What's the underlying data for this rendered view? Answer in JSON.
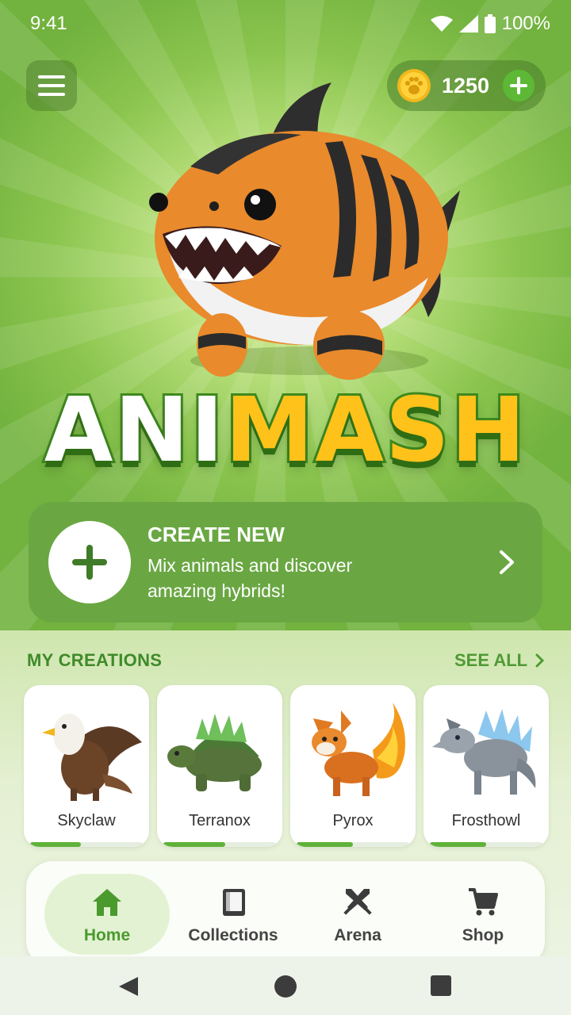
{
  "status_bar": {
    "time": "9:41",
    "battery": "100%"
  },
  "coins": {
    "count": "1250"
  },
  "logo": {
    "part1": "ANI",
    "part2": "MASH"
  },
  "create_card": {
    "title": "CREATE NEW",
    "subtitle": "Mix animals and discover amazing hybrids!"
  },
  "creations": {
    "title": "MY CREATIONS",
    "see_all": "SEE ALL",
    "items": [
      {
        "name": "Skyclaw",
        "progress": 0.45
      },
      {
        "name": "Terranox",
        "progress": 0.55
      },
      {
        "name": "Pyrox",
        "progress": 0.5
      },
      {
        "name": "Frosthowl",
        "progress": 0.5
      }
    ]
  },
  "nav": {
    "items": [
      {
        "label": "Home",
        "icon": "home-icon",
        "active": true
      },
      {
        "label": "Collections",
        "icon": "book-icon",
        "active": false
      },
      {
        "label": "Arena",
        "icon": "crossed-swords-icon",
        "active": false
      },
      {
        "label": "Shop",
        "icon": "cart-icon",
        "active": false
      }
    ]
  },
  "colors": {
    "brand_green": "#6aa743",
    "accent_yellow": "#ffc21a",
    "active_green": "#4a9a2d"
  }
}
